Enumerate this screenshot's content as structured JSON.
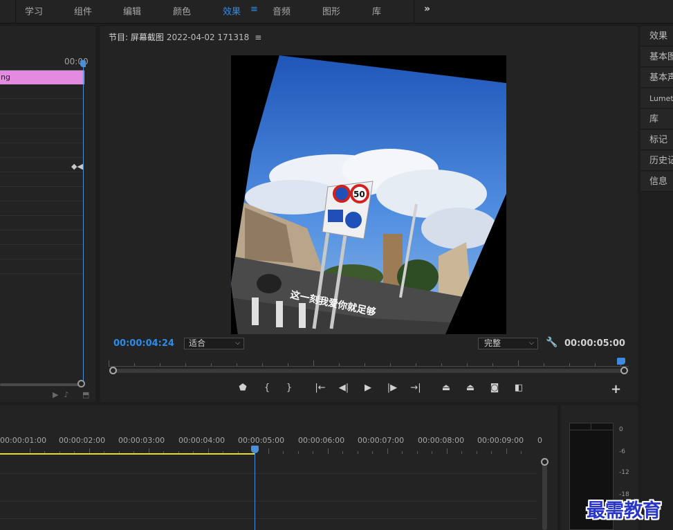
{
  "workspace_tabs": [
    {
      "label": "学习"
    },
    {
      "label": "组件"
    },
    {
      "label": "编辑"
    },
    {
      "label": "颜色"
    },
    {
      "label": "效果",
      "active": true
    },
    {
      "label": "音频"
    },
    {
      "label": "图形"
    },
    {
      "label": "库"
    }
  ],
  "workspace_menu_icon": "≡",
  "workspace_overflow": "»",
  "effect_controls": {
    "timecode": "00:00",
    "clip_label": "ng",
    "keyframe_icon": "keyframe-diamond-icon"
  },
  "program_monitor": {
    "title": "节目: 屏幕截图",
    "sequence_timestamp": "2022-04-02 171318",
    "menu_icon": "≡",
    "current_timecode": "00:00:04:24",
    "fit_label": "适合",
    "quality_label": "完整",
    "duration_timecode": "00:00:05:00",
    "video_caption": "这一刻我爱你就足够",
    "speed_sign": "50"
  },
  "right_panels": [
    {
      "label": "效果"
    },
    {
      "label": "基本图"
    },
    {
      "label": "基本声"
    },
    {
      "label": "Lumetri"
    },
    {
      "label": "库"
    },
    {
      "label": "标记"
    },
    {
      "label": "历史记"
    },
    {
      "label": "信息"
    }
  ],
  "timeline": {
    "ruler_labels": [
      "00:00:01:00",
      "00:00:02:00",
      "00:00:03:00",
      "00:00:04:00",
      "00:00:05:00",
      "00:00:06:00",
      "00:00:07:00",
      "00:00:08:00",
      "00:00:09:00",
      "0"
    ]
  },
  "audio_meter": {
    "scale": [
      "0",
      "-6",
      "-12",
      "-18"
    ]
  },
  "watermark": "最需教育"
}
